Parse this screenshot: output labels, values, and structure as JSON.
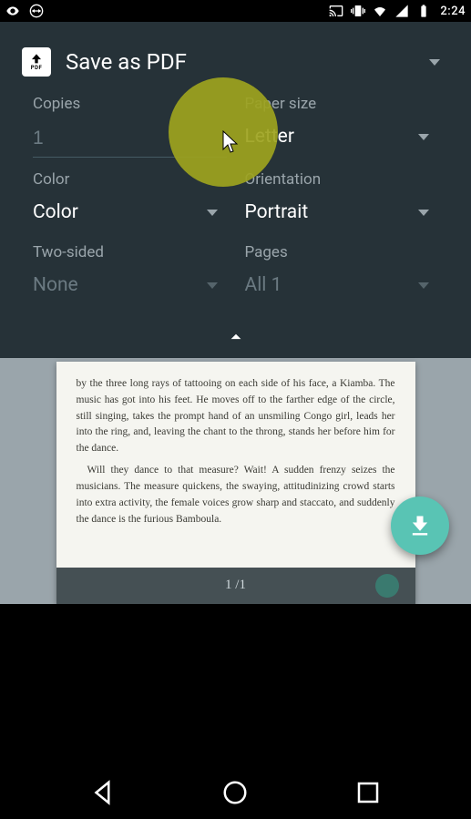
{
  "statusbar": {
    "clock": "2:24"
  },
  "destination": {
    "label": "Save as PDF"
  },
  "fields": {
    "copies": {
      "label": "Copies",
      "value": "1"
    },
    "paper_size": {
      "label": "Paper size",
      "value": "Letter"
    },
    "color": {
      "label": "Color",
      "value": "Color"
    },
    "orientation": {
      "label": "Orientation",
      "value": "Portrait"
    },
    "two_sided": {
      "label": "Two-sided",
      "value": "None"
    },
    "pages": {
      "label": "Pages",
      "value": "All 1"
    }
  },
  "preview": {
    "page_indicator": "1 /1",
    "paragraph1": "by the three long rays of tattooing on each side of his face, a Kiamba. The music has got into his feet. He moves off to the farther edge of the circle, still singing, takes the prompt hand of an unsmiling Congo girl, leads her into the ring, and, leaving the chant to the throng, stands her before him for the dance.",
    "paragraph2": "Will they dance to that measure? Wait! A sudden frenzy seizes the musicians. The measure quickens, the swaying, attitudinizing crowd starts into extra activity, the female voices grow sharp and staccato, and suddenly the dance is the furious Bamboula."
  }
}
